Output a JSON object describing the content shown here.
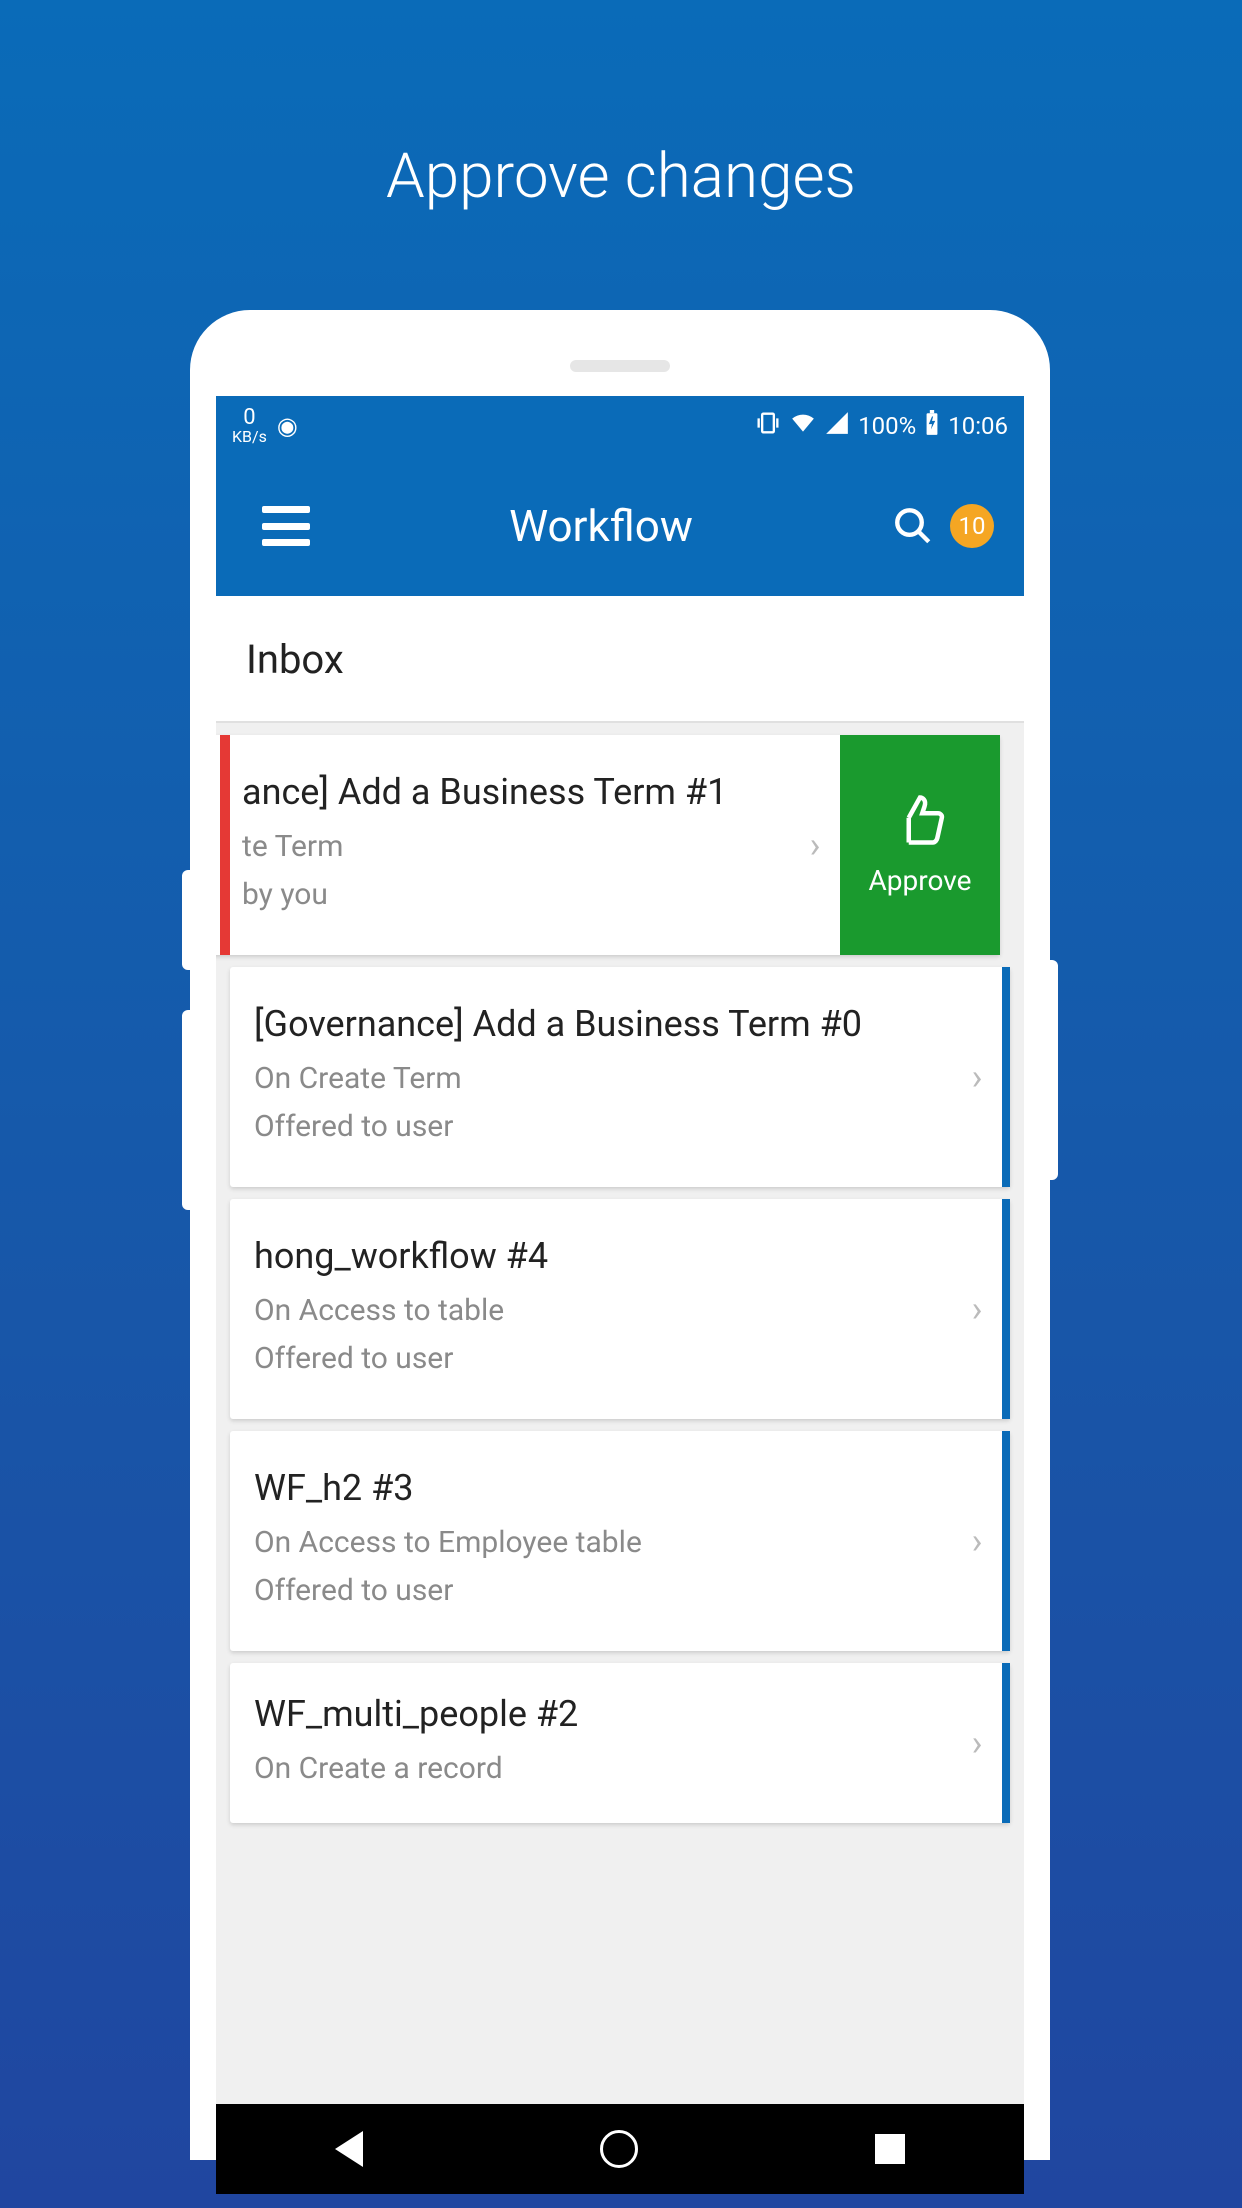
{
  "marketing": {
    "title": "Approve changes"
  },
  "statusbar": {
    "data_rate_num": "0",
    "data_rate_unit": "KB/s",
    "battery_text": "100%",
    "time": "10:06"
  },
  "appbar": {
    "title": "Workflow",
    "badge_count": "10"
  },
  "section": {
    "header": "Inbox"
  },
  "swipe_action": {
    "approve_label": "Approve"
  },
  "items": [
    {
      "title": "ance] Add a Business Term #1",
      "sub1": "te Term",
      "sub2": "by you"
    },
    {
      "title": "[Governance] Add a Business Term #0",
      "sub1": "On Create Term",
      "sub2": "Offered to user"
    },
    {
      "title": "hong_workflow #4",
      "sub1": "On Access to table",
      "sub2": "Offered to user"
    },
    {
      "title": "WF_h2 #3",
      "sub1": "On Access to Employee table",
      "sub2": "Offered to user"
    },
    {
      "title": "WF_multi_people #2",
      "sub1": "On Create a record",
      "sub2": ""
    }
  ]
}
